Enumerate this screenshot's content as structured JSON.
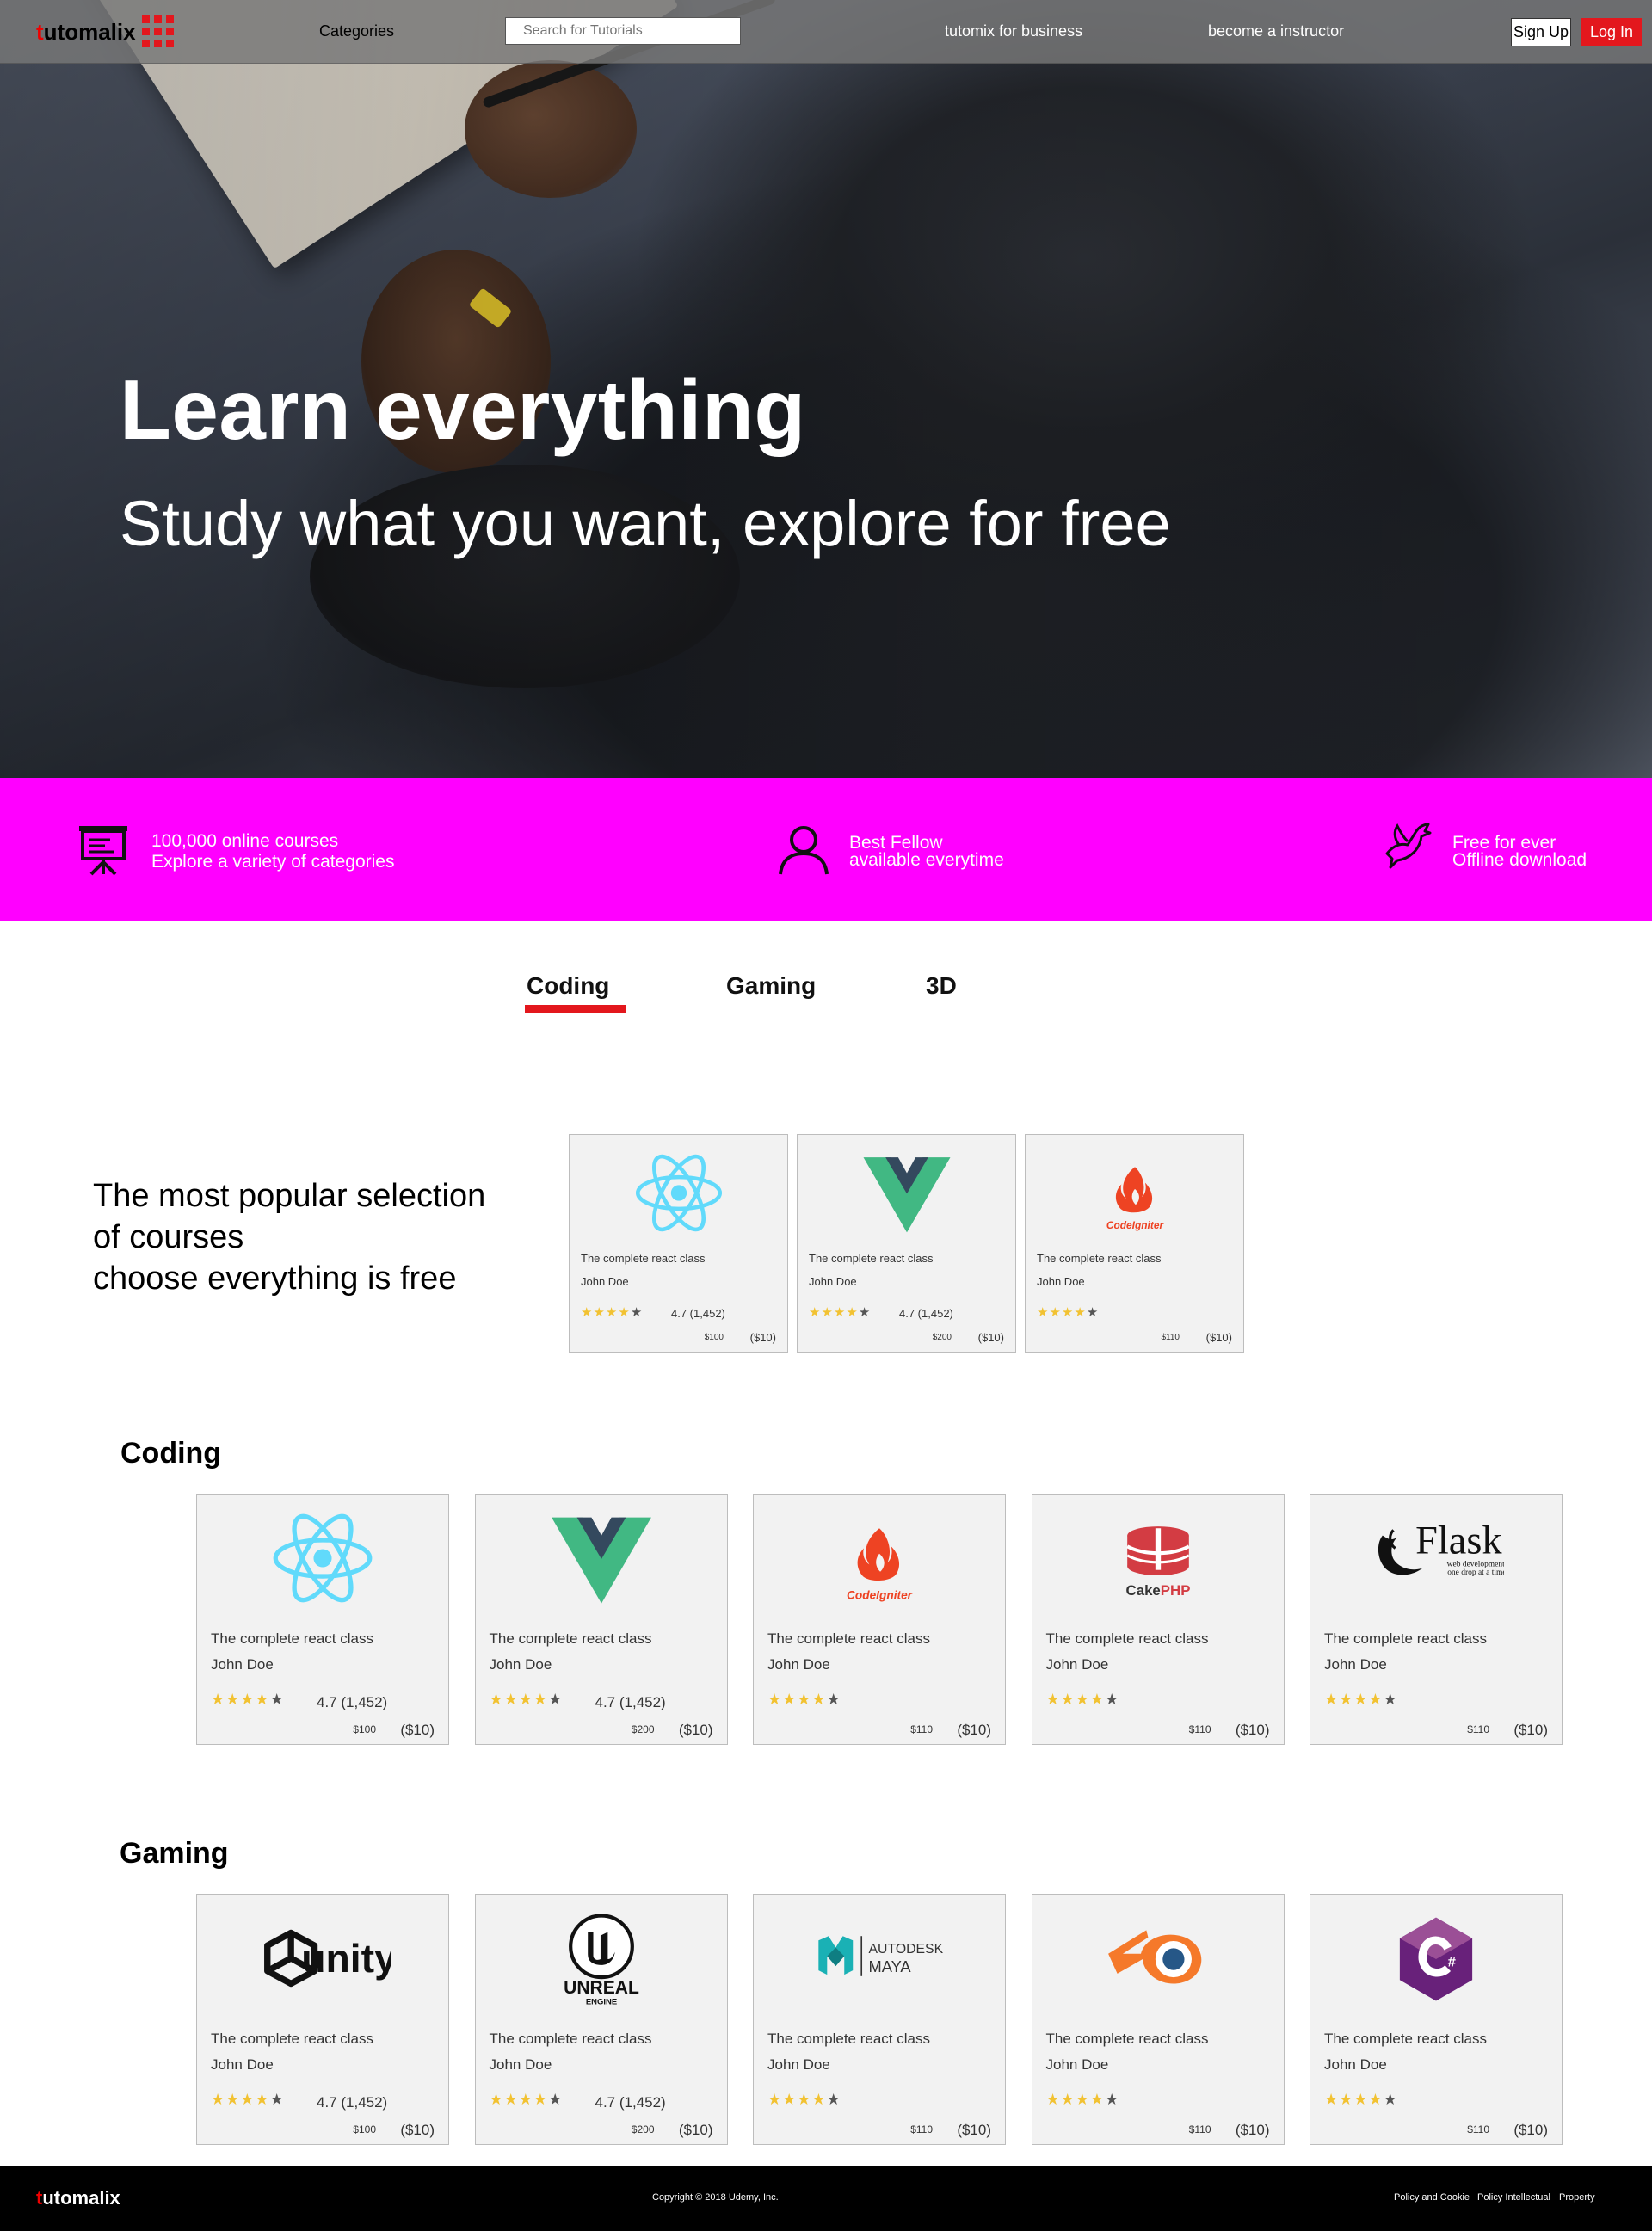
{
  "nav": {
    "logo_first": "t",
    "logo_rest": "utomalix",
    "categories": "Categories",
    "search_placeholder": "Search for Tutorials",
    "business": "tutomix for business",
    "instructor": "become a instructor",
    "signup": "Sign Up",
    "login": "Log In"
  },
  "hero": {
    "title": "Learn everything",
    "subtitle": "Study what you want, explore for free"
  },
  "features": [
    {
      "icon": "presentation-board-icon",
      "line1": "100,000 online courses",
      "line2": "Explore a variety of categories"
    },
    {
      "icon": "user-icon",
      "line1": "Best Fellow",
      "line2": "available everytime"
    },
    {
      "icon": "dove-icon",
      "line1": "Free for ever",
      "line2": "Offline download"
    }
  ],
  "tabs": {
    "active": "Coding",
    "items": [
      "Coding",
      "Gaming",
      "3D"
    ]
  },
  "popular": {
    "line1": "The most popular selection",
    "line2": "of courses",
    "line3": "choose everything is free",
    "cards": [
      {
        "logo": "react-logo",
        "title": "The complete react class",
        "author": "John Doe",
        "rating": "4.7 (1,452)",
        "price": "$100",
        "sale": "($10)"
      },
      {
        "logo": "vue-logo",
        "title": "The complete react class",
        "author": "John Doe",
        "rating": "4.7 (1,452)",
        "price": "$200",
        "sale": "($10)"
      },
      {
        "logo": "codeigniter-logo",
        "title": "The complete react class",
        "author": "John Doe",
        "rating": "",
        "price": "$110",
        "sale": "($10)"
      }
    ]
  },
  "coding": {
    "title": "Coding",
    "cards": [
      {
        "logo": "react-logo",
        "title": "The complete react class",
        "author": "John Doe",
        "rating": "4.7 (1,452)",
        "price": "$100",
        "sale": "($10)"
      },
      {
        "logo": "vue-logo",
        "title": "The complete react class",
        "author": "John Doe",
        "rating": "4.7 (1,452)",
        "price": "$200",
        "sale": "($10)"
      },
      {
        "logo": "codeigniter-logo",
        "title": "The complete react class",
        "author": "John Doe",
        "rating": "",
        "price": "$110",
        "sale": "($10)"
      },
      {
        "logo": "cakephp-logo",
        "title": "The complete react class",
        "author": "John Doe",
        "rating": "",
        "price": "$110",
        "sale": "($10)"
      },
      {
        "logo": "flask-logo",
        "title": "The complete react class",
        "author": "John Doe",
        "rating": "",
        "price": "$110",
        "sale": "($10)"
      }
    ]
  },
  "gaming": {
    "title": "Gaming",
    "cards": [
      {
        "logo": "unity-logo",
        "title": "The complete react class",
        "author": "John Doe",
        "rating": "4.7 (1,452)",
        "price": "$100",
        "sale": "($10)"
      },
      {
        "logo": "unreal-engine-logo",
        "title": "The complete react class",
        "author": "John Doe",
        "rating": "4.7 (1,452)",
        "price": "$200",
        "sale": "($10)"
      },
      {
        "logo": "autodesk-maya-logo",
        "title": "The complete react class",
        "author": "John Doe",
        "rating": "",
        "price": "$110",
        "sale": "($10)"
      },
      {
        "logo": "blender-logo",
        "title": "The complete react class",
        "author": "John Doe",
        "rating": "",
        "price": "$110",
        "sale": "($10)"
      },
      {
        "logo": "csharp-logo",
        "title": "The complete react class",
        "author": "John Doe",
        "rating": "",
        "price": "$110",
        "sale": "($10)"
      }
    ]
  },
  "logo_text": {
    "codeigniter": "CodeIgniter",
    "cakephp_a": "Cake",
    "cakephp_b": "PHP",
    "flask": "Flask",
    "flask_tag1": "web development,",
    "flask_tag2": "one drop at a time",
    "unity": "unity",
    "unreal1": "UNREAL",
    "unreal2": "ENGINE",
    "autodesk": "AUTODESK",
    "maya": "MAYA"
  },
  "stars": {
    "filled": 4,
    "total": 5
  },
  "colors": {
    "accent": "#e3171d",
    "band": "#ff00ff",
    "star": "#f2c232",
    "react": "#61dafb",
    "vue_green": "#41b883",
    "vue_dark": "#34495e"
  },
  "footer": {
    "logo_first": "t",
    "logo_rest": "utomalix",
    "copyright": "Copyright © 2018 Udemy, Inc.",
    "links": [
      "Policy and Cookie",
      "Policy Intellectual",
      "Property"
    ]
  }
}
